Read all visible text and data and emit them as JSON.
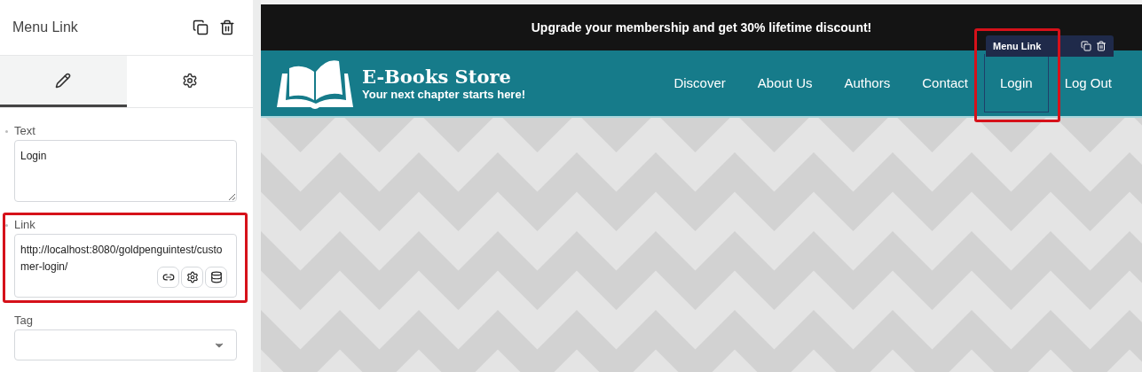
{
  "panel": {
    "title": "Menu Link"
  },
  "tabs": [
    {
      "kind": "pencil",
      "selected": true
    },
    {
      "kind": "gear",
      "selected": false
    }
  ],
  "fields": [
    {
      "kind": "textarea",
      "label": "Text",
      "value": "Login",
      "highlighted": false
    },
    {
      "kind": "link",
      "label": "Link",
      "value": "http://localhost:8080/goldpenguintest/customer-login/",
      "highlighted": true
    },
    {
      "kind": "select",
      "label": "Tag",
      "highlighted": false
    }
  ],
  "preview": {
    "banner": "Upgrade your membership and get 30% lifetime discount!",
    "brand": {
      "title": "E-Books Store",
      "tagline": "Your next chapter starts here!"
    },
    "nav": [
      {
        "label": "Discover",
        "selected": false
      },
      {
        "label": "About Us",
        "selected": false
      },
      {
        "label": "Authors",
        "selected": false
      },
      {
        "label": "Contact",
        "selected": false
      },
      {
        "label": "Login",
        "selected": true
      },
      {
        "label": "Log Out",
        "selected": false
      }
    ],
    "element_tag": "Menu Link"
  }
}
